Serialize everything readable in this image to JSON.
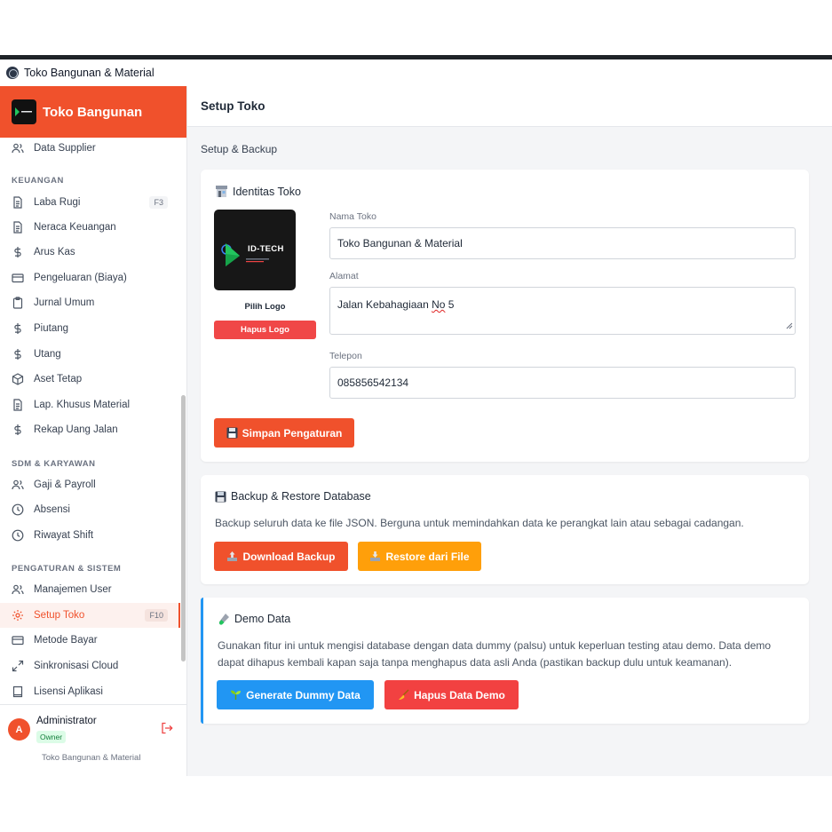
{
  "window": {
    "title": "Toko Bangunan & Material"
  },
  "brand": {
    "name": "Toko Bangunan"
  },
  "sidebar": {
    "items": [
      {
        "label": "Data Supplier",
        "icon": "users-icon"
      },
      {
        "label": "Laba Rugi",
        "icon": "document-icon",
        "shortcut": "F3"
      },
      {
        "label": "Neraca Keuangan",
        "icon": "document-icon"
      },
      {
        "label": "Arus Kas",
        "icon": "dollar-icon"
      },
      {
        "label": "Pengeluaran (Biaya)",
        "icon": "card-icon"
      },
      {
        "label": "Jurnal Umum",
        "icon": "clipboard-icon"
      },
      {
        "label": "Piutang",
        "icon": "dollar-icon"
      },
      {
        "label": "Utang",
        "icon": "dollar-icon"
      },
      {
        "label": "Aset Tetap",
        "icon": "box-icon"
      },
      {
        "label": "Lap. Khusus Material",
        "icon": "document-icon"
      },
      {
        "label": "Rekap Uang Jalan",
        "icon": "dollar-icon"
      },
      {
        "label": "Gaji & Payroll",
        "icon": "users-icon"
      },
      {
        "label": "Absensi",
        "icon": "clock-icon"
      },
      {
        "label": "Riwayat Shift",
        "icon": "clock-icon"
      },
      {
        "label": "Manajemen User",
        "icon": "users-icon"
      },
      {
        "label": "Setup Toko",
        "icon": "gear-icon",
        "shortcut": "F10"
      },
      {
        "label": "Metode Bayar",
        "icon": "card-icon"
      },
      {
        "label": "Sinkronisasi Cloud",
        "icon": "expand-icon"
      },
      {
        "label": "Lisensi Aplikasi",
        "icon": "book-icon"
      }
    ],
    "sections": {
      "keuangan": "KEUANGAN",
      "sdm": "SDM & KARYAWAN",
      "pengaturan": "PENGATURAN & SISTEM"
    },
    "active_item": "Setup Toko",
    "user": {
      "initial": "A",
      "name": "Administrator",
      "role": "Owner",
      "store": "Toko Bangunan & Material"
    }
  },
  "header": {
    "title": "Setup Toko"
  },
  "breadcrumb": "Setup & Backup",
  "identity": {
    "title": "Identitas Toko",
    "logo_text": "ID-TECH",
    "pick_logo": "Pilih Logo",
    "delete_logo": "Hapus Logo",
    "name_label": "Nama Toko",
    "name_value": "Toko Bangunan & Material",
    "address_label": "Alamat",
    "address_prefix": "Jalan Kebahagiaan ",
    "address_flagged_word": "No",
    "address_suffix": " 5",
    "phone_label": "Telepon",
    "phone_value": "085856542134",
    "save_label": "Simpan Pengaturan"
  },
  "backup": {
    "title": "Backup & Restore Database",
    "description": "Backup seluruh data ke file JSON. Berguna untuk memindahkan data ke perangkat lain atau sebagai cadangan.",
    "download_label": "Download Backup",
    "restore_label": "Restore dari File"
  },
  "demo": {
    "title": "Demo Data",
    "description": "Gunakan fitur ini untuk mengisi database dengan data dummy (palsu) untuk keperluan testing atau demo. Data demo dapat dihapus kembali kapan saja tanpa menghapus data asli Anda (pastikan backup dulu untuk keamanan).",
    "generate_label": "Generate Dummy Data",
    "delete_label": "Hapus Data Demo"
  },
  "colors": {
    "accent": "#f0512c",
    "orange": "#ff9f0a",
    "blue": "#2196f3",
    "red": "#f24141"
  }
}
